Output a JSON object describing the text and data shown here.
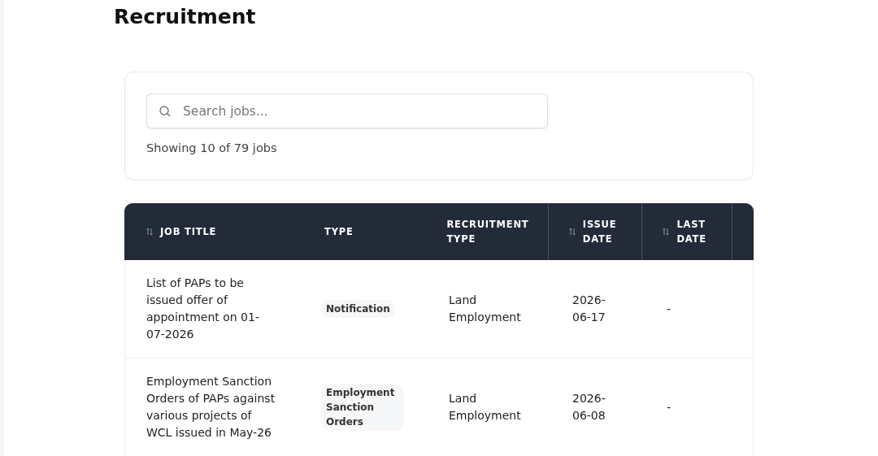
{
  "page_title": "Recruitment",
  "search": {
    "placeholder": "Search jobs..."
  },
  "result_count": "Showing 10 of 79 jobs",
  "table": {
    "columns": [
      {
        "label": "JOB TITLE",
        "sortable": true
      },
      {
        "label": "TYPE",
        "sortable": false
      },
      {
        "label": "RECRUITMENT TYPE",
        "sortable": false
      },
      {
        "label": "ISSUE DATE",
        "sortable": true
      },
      {
        "label": "LAST DATE",
        "sortable": true
      }
    ],
    "rows": [
      {
        "job_title": "List of PAPs to be issued offer of appointment on 01-07-2026",
        "type": "Notification",
        "recruitment_type": "Land Employment",
        "issue_date": "2026-06-17",
        "last_date": "-"
      },
      {
        "job_title": "Employment Sanction Orders of PAPs against various projects of WCL issued in May-26",
        "type": "Employment Sanction Orders",
        "recruitment_type": "Land Employment",
        "issue_date": "2026-06-08",
        "last_date": "-"
      }
    ]
  }
}
